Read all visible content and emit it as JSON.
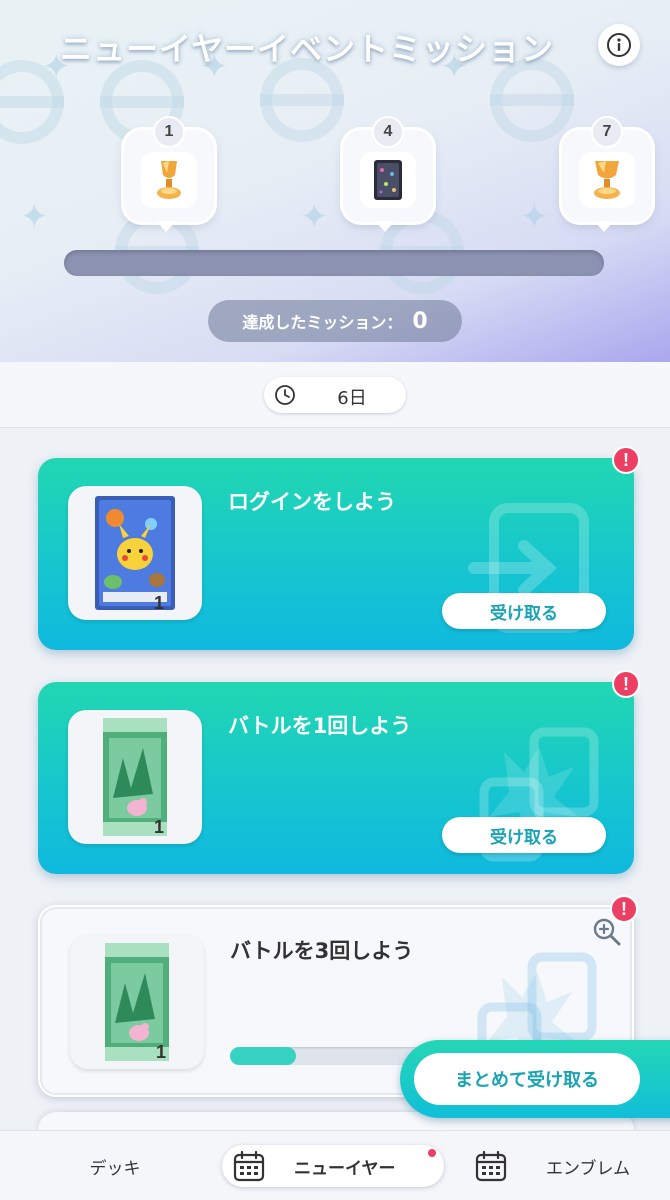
{
  "header": {
    "title": "ニューイヤーイベントミッション",
    "milestones": [
      {
        "step": "1",
        "icon": "trophy-icon"
      },
      {
        "step": "4",
        "icon": "card-sleeve-icon"
      },
      {
        "step": "7",
        "icon": "trophy-icon"
      }
    ],
    "progress": 0,
    "missions_done_label": "達成したミッション：",
    "missions_done_value": "0"
  },
  "timer": {
    "remaining": "6日"
  },
  "missions": [
    {
      "title": "ログインをしよう",
      "reward_count": "1",
      "reward": "pikachu-card",
      "claim_label": "受け取る",
      "state": "claimable"
    },
    {
      "title": "バトルを1回しよう",
      "reward_count": "1",
      "reward": "booster-pack",
      "claim_label": "受け取る",
      "state": "claimable"
    },
    {
      "title": "バトルを3回しよう",
      "reward_count": "1",
      "reward": "booster-pack",
      "state": "in-progress",
      "progress": 0.33
    }
  ],
  "bulk_claim_label": "まとめて受け取る",
  "bottom_nav": [
    {
      "label": "デッキ"
    },
    {
      "label": "ニューイヤー",
      "selected": true
    },
    {
      "label": "エンブレム"
    }
  ],
  "colors": {
    "accent_teal": "#16c6ce",
    "alert_red": "#ec3f63"
  }
}
